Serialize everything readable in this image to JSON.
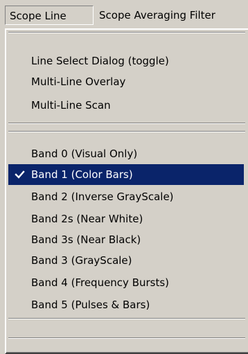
{
  "menubar": {
    "items": [
      {
        "label": "Scope Line",
        "state": "open"
      },
      {
        "label": "Scope Averaging Filter",
        "state": "closed"
      }
    ]
  },
  "dropdown": {
    "group1": [
      {
        "label": "Line Select Dialog (toggle)"
      },
      {
        "label": "Multi-Line Overlay"
      },
      {
        "label": "Multi-Line Scan"
      }
    ],
    "group2": [
      {
        "label": "Band 0 (Visual Only)",
        "checked": false
      },
      {
        "label": "Band 1 (Color Bars)",
        "checked": true
      },
      {
        "label": "Band 2 (Inverse GrayScale)",
        "checked": false
      },
      {
        "label": "Band 2s (Near White)",
        "checked": false
      },
      {
        "label": "Band 3s (Near Black)",
        "checked": false
      },
      {
        "label": "Band 3 (GrayScale)",
        "checked": false
      },
      {
        "label": "Band 4 (Frequency Bursts)",
        "checked": false
      },
      {
        "label": "Band 5 (Pulses & Bars)",
        "checked": false
      }
    ]
  },
  "colors": {
    "face": "#d4d0c8",
    "highlight": "#0a246a",
    "highlight_text": "#ffffff"
  }
}
